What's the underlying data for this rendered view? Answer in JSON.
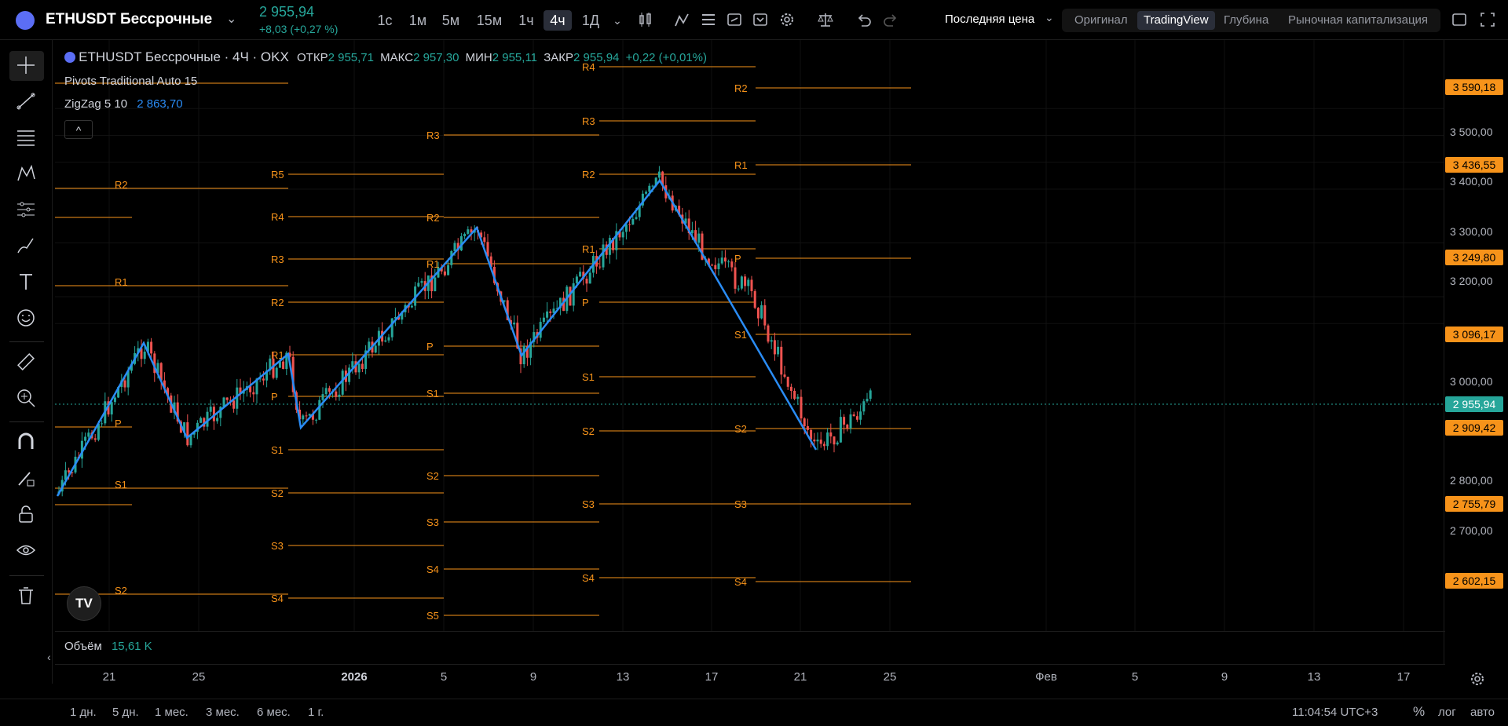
{
  "header": {
    "symbol": "ETHUSDT Бессрочные",
    "price": "2 955,94",
    "change": "+8,03 (+0,27 %)",
    "timeframes": [
      "1с",
      "1м",
      "5м",
      "15м",
      "1ч",
      "4ч",
      "1Д"
    ],
    "active_timeframe": "4ч",
    "price_mode": "Последняя цена",
    "views": [
      "Оригинал",
      "TradingView",
      "Глубина",
      "Рыночная капитализация"
    ],
    "active_view": "TradingView"
  },
  "legend": {
    "title": "ETHUSDT Бессрочные · 4Ч · OKX",
    "open_label": "ОТКР",
    "open": "2 955,71",
    "high_label": "МАКС",
    "high": "2 957,30",
    "low_label": "МИН",
    "low": "2 955,11",
    "close_label": "ЗАКР",
    "close": "2 955,94",
    "change": "+0,22 (+0,01%)",
    "pivots": "Pivots Traditional Auto 15",
    "zigzag": "ZigZag 5 10",
    "zigzag_value": "2 863,70",
    "volume_label": "Объём",
    "volume_value": "15,61 K"
  },
  "price_axis": {
    "labels": [
      "3 500,00",
      "3 400,00",
      "3 300,00",
      "3 200,00",
      "3 000,00",
      "2 800,00",
      "2 700,00"
    ],
    "tags": [
      "3 590,18",
      "3 436,55",
      "3 249,80",
      "3 096,17",
      "2 909,42",
      "2 755,79",
      "2 602,15"
    ],
    "last_price": "2 955,94"
  },
  "time_axis": {
    "labels": [
      "21",
      "25",
      "2026",
      "5",
      "9",
      "13",
      "17",
      "21",
      "25",
      "Фев",
      "5",
      "9",
      "13",
      "17"
    ]
  },
  "bottom": {
    "ranges": [
      "1 дн.",
      "5 дн.",
      "1 мес.",
      "3 мес.",
      "6 мес.",
      "1 г."
    ],
    "time": "11:04:54 UTC+3",
    "percent": "%",
    "log": "лог",
    "auto": "авто"
  },
  "pivot_labels": {
    "p1": [
      "R2",
      "R1",
      "P",
      "S1",
      "S2"
    ],
    "p2": [
      "R5",
      "R4",
      "R3",
      "R2",
      "R1",
      "P",
      "S1",
      "S2",
      "S3",
      "S4"
    ],
    "p3": [
      "R3",
      "R2",
      "R1",
      "P",
      "S1",
      "S2",
      "S3",
      "S4",
      "S5"
    ],
    "p4": [
      "R4",
      "R3",
      "R2",
      "R1",
      "P",
      "S1",
      "S2",
      "S3",
      "S4"
    ],
    "p5": [
      "R2",
      "R1",
      "P",
      "S1",
      "S2",
      "S3",
      "S4"
    ]
  },
  "colors": {
    "pivot": "#f7931a",
    "zigzag": "#2a8cf5",
    "up": "#26a69a",
    "down": "#ef5350"
  }
}
